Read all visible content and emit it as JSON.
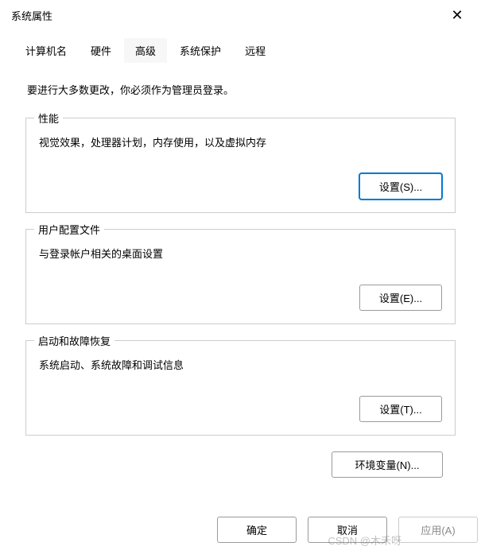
{
  "window": {
    "title": "系统属性",
    "close_icon": "✕"
  },
  "tabs": {
    "t0": "计算机名",
    "t1": "硬件",
    "t2": "高级",
    "t3": "系统保护",
    "t4": "远程"
  },
  "advanced": {
    "admin_note": "要进行大多数更改，你必须作为管理员登录。",
    "performance": {
      "legend": "性能",
      "desc": "视觉效果，处理器计划，内存使用，以及虚拟内存",
      "button": "设置(S)..."
    },
    "user_profiles": {
      "legend": "用户配置文件",
      "desc": "与登录帐户相关的桌面设置",
      "button": "设置(E)..."
    },
    "startup": {
      "legend": "启动和故障恢复",
      "desc": "系统启动、系统故障和调试信息",
      "button": "设置(T)..."
    },
    "env_button": "环境变量(N)..."
  },
  "footer": {
    "ok": "确定",
    "cancel": "取消",
    "apply": "应用(A)"
  },
  "watermark": "CSDN @木禾呀"
}
